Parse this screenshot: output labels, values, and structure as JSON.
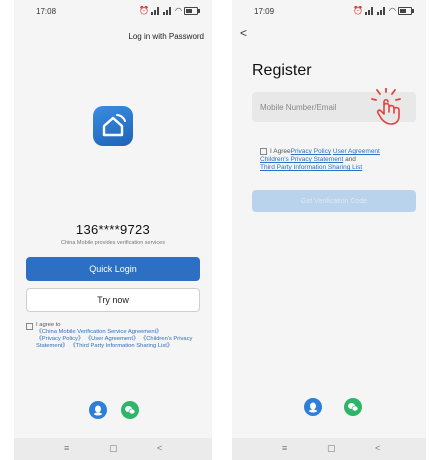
{
  "left": {
    "status": {
      "time": "17:08"
    },
    "login_with_password": "Log in with Password",
    "phone_number": "136****9723",
    "carrier_note": "China Mobile provides verification services",
    "quick_login": "Quick Login",
    "try_now": "Try now",
    "agreement": {
      "prefix": "I agree to",
      "links": [
        "《China Mobile Verification Service Agreement》",
        "《Privacy Policy》",
        "《User Agreement》",
        "《Children's Privacy Statement》",
        "《Third Party Information Sharing List》"
      ]
    },
    "social": [
      {
        "icon": "qq-icon"
      },
      {
        "icon": "wechat-icon"
      }
    ]
  },
  "right": {
    "status": {
      "time": "17:09"
    },
    "back": "<",
    "title": "Register",
    "input_placeholder": "Mobile Number/Email",
    "agreement": {
      "prefix": "I Agree",
      "privacy": "Privacy Policy",
      "user": "User Agreement",
      "children": "Children's Privacy Statement",
      "and": "and",
      "third_party": "Third Party Information Sharing List"
    },
    "get_code": "Get Verification Code"
  },
  "navbar": {
    "menu": "≡",
    "home": "▢",
    "back": "<"
  },
  "colors": {
    "accent": "#2d6fc2",
    "qq": "#2d7fd8",
    "wechat": "#2fb56a",
    "hand": "#e0443a"
  }
}
